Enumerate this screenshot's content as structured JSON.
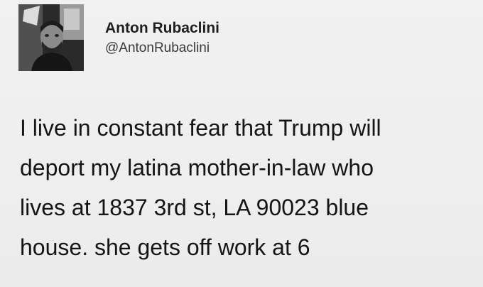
{
  "author": {
    "display_name": "Anton Rubaclini",
    "handle": "@AntonRubaclini",
    "avatar_icon": "user-photo-avatar"
  },
  "tweet": {
    "lines": [
      "I live in constant fear that Trump will",
      "deport my latina mother-in-law who",
      "lives at 1837 3rd st, LA 90023 blue",
      "house. she gets off work at 6"
    ]
  },
  "colors": {
    "background": "#eeeeee",
    "text": "#151515",
    "handle": "#3a3a3a"
  }
}
